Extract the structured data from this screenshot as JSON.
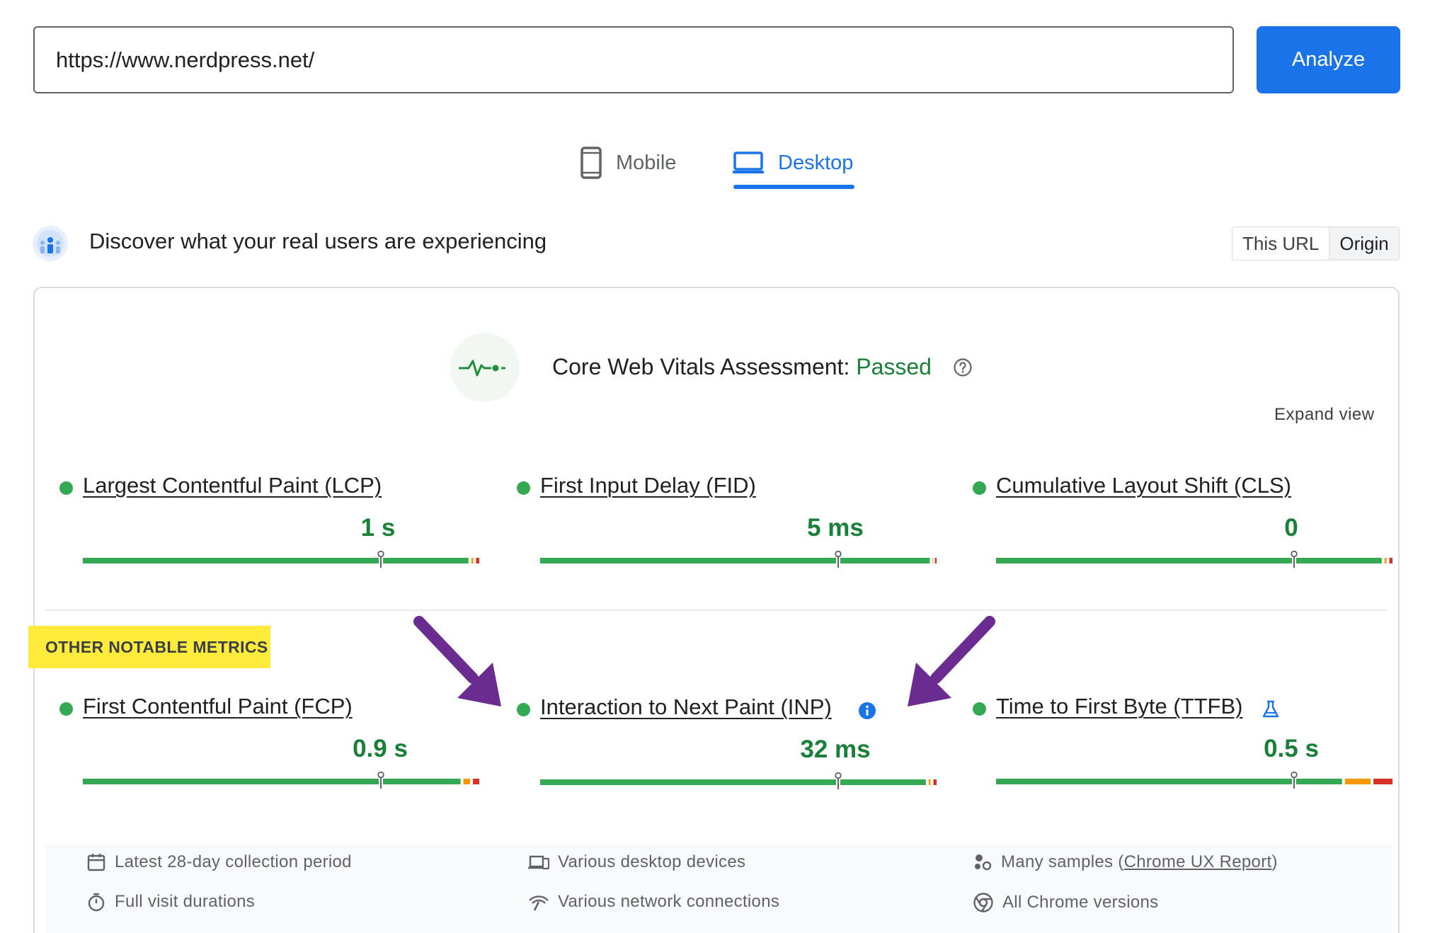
{
  "search": {
    "url_value": "https://www.nerdpress.net/",
    "analyze_label": "Analyze"
  },
  "tabs": [
    {
      "label": "Mobile",
      "icon": "smartphone-icon",
      "active": false
    },
    {
      "label": "Desktop",
      "icon": "laptop-icon",
      "active": true
    }
  ],
  "field_data": {
    "title": "Discover what your real users are experiencing",
    "toggle": [
      {
        "label": "This URL",
        "active": false
      },
      {
        "label": "Origin",
        "active": true
      }
    ]
  },
  "assessment": {
    "label": "Core Web Vitals Assessment:",
    "status": "Passed",
    "expand_label": "Expand view"
  },
  "core_metrics": [
    {
      "name": "Largest Contentful Paint (LCP)",
      "value": "1 s",
      "good_fraction": 0.98
    },
    {
      "name": "First Input Delay (FID)",
      "value": "5 ms",
      "good_fraction": 0.99
    },
    {
      "name": "Cumulative Layout Shift (CLS)",
      "value": "0",
      "good_fraction": 0.98
    }
  ],
  "other_label": "OTHER NOTABLE METRICS",
  "other_metrics": [
    {
      "name": "First Contentful Paint (FCP)",
      "value": "0.9 s",
      "good_fraction": 0.96
    },
    {
      "name": "Interaction to Next Paint (INP)",
      "value": "32 ms",
      "good_fraction": 0.98
    },
    {
      "name": "Time to First Byte (TTFB)",
      "value": "0.5 s",
      "good_fraction": 0.88
    }
  ],
  "footer": {
    "period": "Latest 28-day collection period",
    "devices": "Various desktop devices",
    "samples_prefix": "Many samples (",
    "samples_link": "Chrome UX Report",
    "samples_suffix": ")",
    "durations": "Full visit durations",
    "network": "Various network connections",
    "chrome": "All Chrome versions"
  },
  "colors": {
    "accent": "#1a73e8",
    "good": "#34a853",
    "needs_improvement": "#f29900",
    "poor": "#d93025",
    "highlight": "#ffeb3b",
    "arrow": "#6a2c91"
  }
}
